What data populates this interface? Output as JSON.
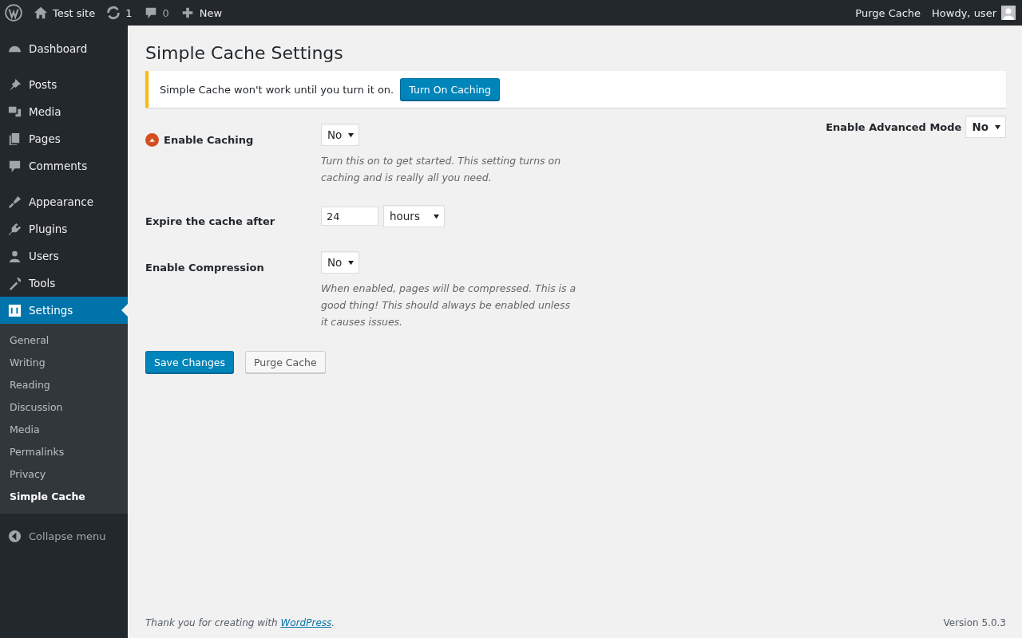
{
  "admin_bar": {
    "site": "Test site",
    "updates": "1",
    "comments": "0",
    "new": "New",
    "purge": "Purge Cache",
    "greeting": "Howdy, user"
  },
  "sidebar": {
    "groups": [
      {
        "items": [
          {
            "label": "Dashboard",
            "selected": false
          }
        ]
      },
      {
        "items": [
          {
            "label": "Posts",
            "selected": false
          },
          {
            "label": "Media",
            "selected": false
          },
          {
            "label": "Pages",
            "selected": false
          },
          {
            "label": "Comments",
            "selected": false
          }
        ]
      },
      {
        "items": [
          {
            "label": "Appearance",
            "selected": false
          },
          {
            "label": "Plugins",
            "selected": false
          },
          {
            "label": "Users",
            "selected": false
          },
          {
            "label": "Tools",
            "selected": false
          },
          {
            "label": "Settings",
            "selected": true
          }
        ]
      }
    ],
    "submenu": [
      {
        "label": "General",
        "selected": false
      },
      {
        "label": "Writing",
        "selected": false
      },
      {
        "label": "Reading",
        "selected": false
      },
      {
        "label": "Discussion",
        "selected": false
      },
      {
        "label": "Media",
        "selected": false
      },
      {
        "label": "Permalinks",
        "selected": false
      },
      {
        "label": "Privacy",
        "selected": false
      },
      {
        "label": "Simple Cache",
        "selected": true
      }
    ],
    "collapse": "Collapse menu"
  },
  "page": {
    "title": "Simple Cache Settings",
    "notice": {
      "text": "Simple Cache won't work until you turn it on.",
      "button": "Turn On Caching"
    },
    "settings": [
      {
        "kind": "select",
        "label": "Enable Caching",
        "warning": true,
        "value": "No",
        "description": "Turn this on to get started. This setting turns on caching and is really all you need."
      },
      {
        "kind": "number_unit",
        "label": "Expire the cache after",
        "warning": false,
        "value": "24",
        "unit": "hours"
      },
      {
        "kind": "select",
        "label": "Enable Compression",
        "warning": false,
        "value": "No",
        "description": "When enabled, pages will be compressed. This is a good thing! This should always be enabled unless it causes issues."
      }
    ],
    "advanced": {
      "label": "Enable Advanced Mode",
      "value": "No"
    },
    "buttons": [
      {
        "label": "Save Changes",
        "primary": true
      },
      {
        "label": "Purge Cache",
        "primary": false
      }
    ]
  },
  "footer": {
    "thanks_before": "Thank you for creating with ",
    "link": "WordPress",
    "thanks_after": ".",
    "version": "Version 5.0.3"
  }
}
